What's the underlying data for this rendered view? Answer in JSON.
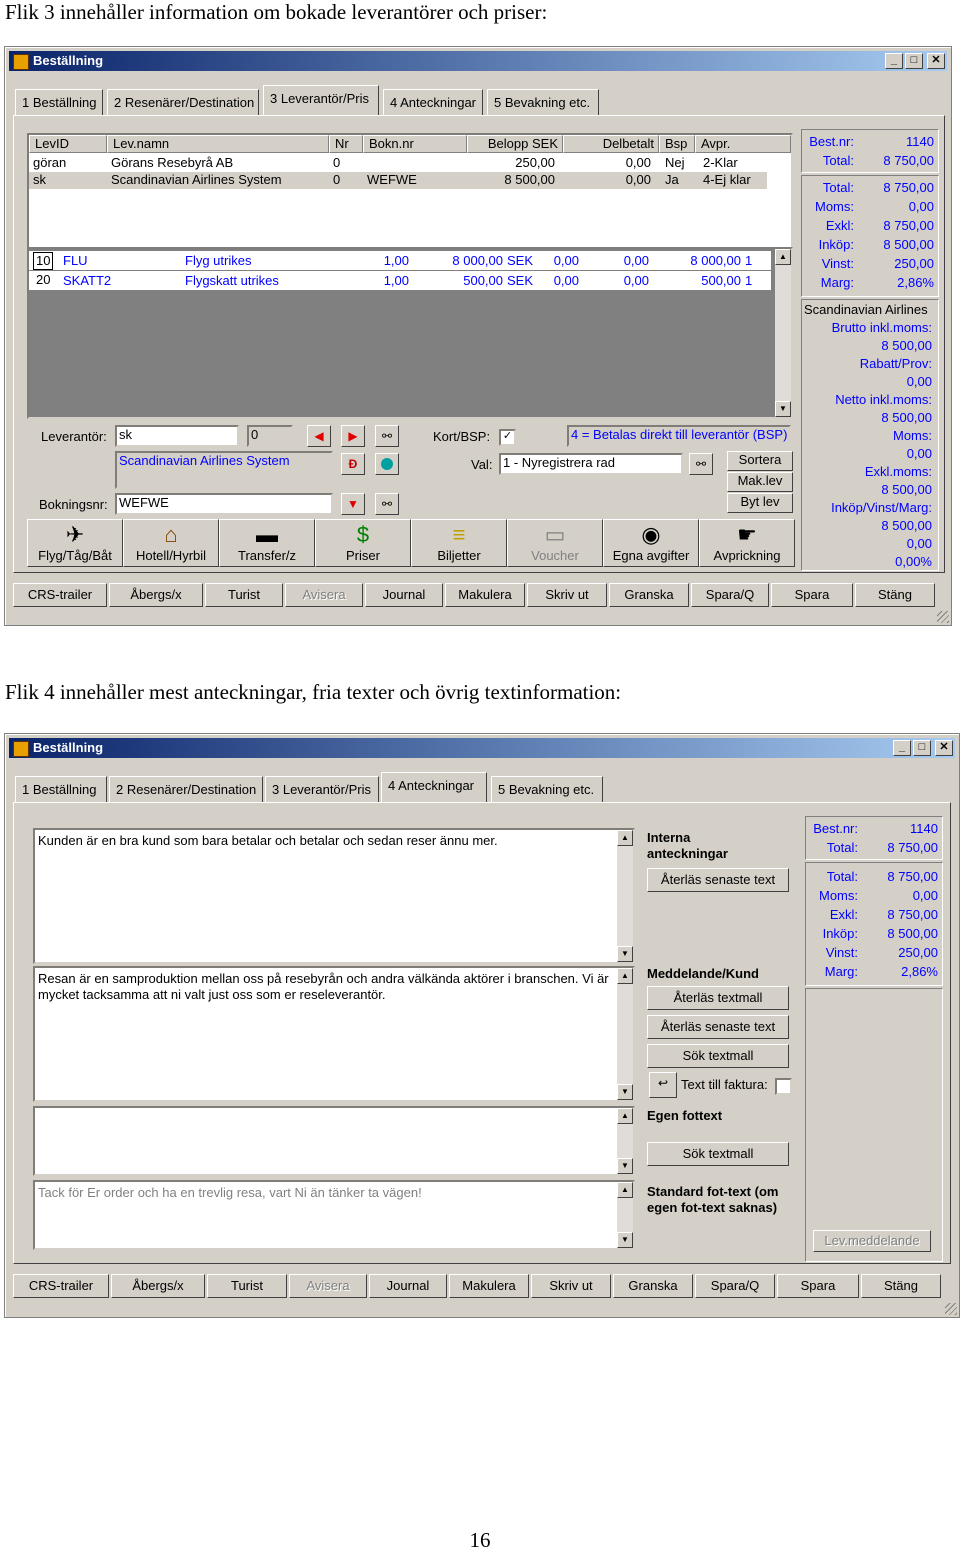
{
  "captions": {
    "tab3": "Flik 3 innehåller information om bokade leverantörer och priser:",
    "tab4": "Flik 4 innehåller mest anteckningar, fria texter och övrig textinformation:"
  },
  "page_number": "16",
  "window": {
    "title": "Beställning",
    "min_btn": "_",
    "max_btn": "□",
    "close_btn": "✕"
  },
  "tabs": [
    "1 Beställning",
    "2 Resenärer/Destination",
    "3 Leverantör/Pris",
    "4 Anteckningar",
    "5 Bevakning etc."
  ],
  "summary": {
    "best_nr_label": "Best.nr:",
    "best_nr": "1140",
    "total_label": "Total:",
    "total": "8 750,00",
    "rows": [
      {
        "k": "Total:",
        "v": "8 750,00"
      },
      {
        "k": "Moms:",
        "v": "0,00"
      },
      {
        "k": "Exkl:",
        "v": "8 750,00"
      },
      {
        "k": "Inköp:",
        "v": "8 500,00"
      },
      {
        "k": "Vinst:",
        "v": "250,00"
      },
      {
        "k": "Marg:",
        "v": "2,86%"
      }
    ]
  },
  "s1": {
    "supplier_table": {
      "headers": [
        "LevID",
        "Lev.namn",
        "Nr",
        "Bokn.nr",
        "Belopp SEK",
        "Delbetalt",
        "Bsp",
        "Avpr."
      ],
      "rows": [
        [
          "göran",
          "Görans Resebyrå AB",
          "0",
          "",
          "250,00",
          "0,00",
          "Nej",
          "2-Klar"
        ],
        [
          "sk",
          "Scandinavian Airlines System",
          "0",
          "WEFWE",
          "8 500,00",
          "0,00",
          "Ja",
          "4-Ej klar"
        ]
      ]
    },
    "price_rows": [
      [
        "10",
        "FLU",
        "Flyg utrikes",
        "1,00",
        "8 000,00",
        "SEK",
        "0,00",
        "0,00",
        "8 000,00",
        "1"
      ],
      [
        "20",
        "SKATT2",
        "Flygskatt utrikes",
        "1,00",
        "500,00",
        "SEK",
        "0,00",
        "0,00",
        "500,00",
        "1"
      ]
    ],
    "form": {
      "leverantor_label": "Leverantör:",
      "leverantor_value": "sk",
      "leverantor_num": "0",
      "supplier_name": "Scandinavian Airlines System",
      "bokningsnr_label": "Bokningsnr:",
      "bokningsnr_value": "WEFWE",
      "kort_label": "Kort/BSP:",
      "bsp_info": "4 = Betalas direkt till leverantör (BSP)",
      "val_label": "Val:",
      "val_value": "1  - Nyregistrera rad",
      "sortera": "Sortera",
      "maklev": "Mak.lev",
      "bytlev": "Byt lev"
    },
    "icon_buttons": [
      "Flyg/Tåg/Båt",
      "Hotell/Hyrbil",
      "Transfer/z",
      "Priser",
      "Biljetter",
      "Voucher",
      "Egna avgifter",
      "Avprickning"
    ],
    "supplier_panel": {
      "name": "Scandinavian Airlines",
      "lines": [
        {
          "label": "Brutto inkl.moms:",
          "value": "8 500,00"
        },
        {
          "label": "Rabatt/Prov:",
          "value": "0,00"
        },
        {
          "label": "Netto inkl.moms:",
          "value": "8 500,00"
        },
        {
          "label": "Moms:",
          "value": "0,00"
        },
        {
          "label": "Exkl.moms:",
          "value": "8 500,00"
        },
        {
          "label": "Inköp/Vinst/Marg:",
          "value": "8 500,00"
        }
      ],
      "extra": [
        "0,00",
        "0,00%"
      ]
    }
  },
  "s2": {
    "notes": {
      "internal_text": "Kunden är en bra kund som bara betalar och betalar och sedan reser ännu mer.",
      "internal_label": "Interna anteckningar",
      "restore_latest": "Återläs senaste text",
      "message_text": "Resan är en samproduktion mellan oss på resebyrån och andra välkända aktörer i branschen. Vi är mycket tacksamma att ni valt just oss som er reseleverantör.",
      "message_label": "Meddelande/Kund",
      "restore_template": "Återläs textmall",
      "restore_latest2": "Återläs senaste text",
      "search_template": "Sök textmall",
      "invoice_text": "Text till faktura:",
      "footer_label": "Egen fottext",
      "search_template2": "Sök textmall",
      "standard_text": "Tack för Er order och ha en trevlig resa, vart Ni än tänker ta vägen!",
      "standard_label": "Standard fot-text (om egen fot-text saknas)",
      "lev_meddelande": "Lev.meddelande"
    }
  },
  "bottom_buttons": [
    "CRS-trailer",
    "Åbergs/x",
    "Turist",
    "Avisera",
    "Journal",
    "Makulera",
    "Skriv ut",
    "Granska",
    "Spara/Q",
    "Spara",
    "Stäng"
  ]
}
